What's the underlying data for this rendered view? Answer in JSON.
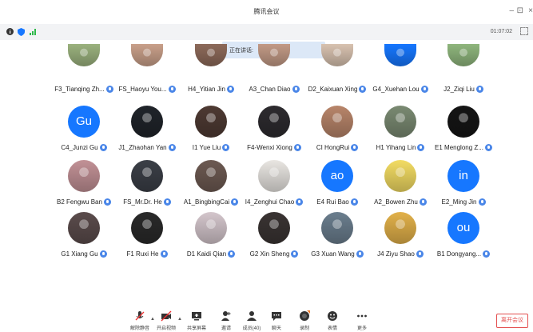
{
  "window": {
    "title": "腾讯会议",
    "minimize_glyph": "–",
    "restore_glyph": "⊡",
    "close_glyph": "×"
  },
  "status": {
    "timer": "01:07:02",
    "icons": [
      "info-icon",
      "shield-icon",
      "signal-icon"
    ]
  },
  "speaking_banner": "正在讲话:",
  "participants": [
    {
      "name": "F3_Tianqing Zh...",
      "initials": "",
      "color": "#9bb27e"
    },
    {
      "name": "FS_Haoyu You...",
      "initials": "",
      "color": "#c9a08a"
    },
    {
      "name": "H4_Yitian Jin",
      "initials": "",
      "color": "#8d6a5a"
    },
    {
      "name": "A3_Chan Diao",
      "initials": "",
      "color": "#c29a86"
    },
    {
      "name": "D2_Kaixuan Xing",
      "initials": "",
      "color": "#d8c2b0"
    },
    {
      "name": "G4_Xuehan Lou",
      "initials": "",
      "color": "#1677ff"
    },
    {
      "name": "J2_Ziqi Liu",
      "initials": "",
      "color": "#8fb67d"
    },
    {
      "name": "C4_Junzi Gu",
      "initials": "Gu",
      "color": "#1677ff"
    },
    {
      "name": "J1_Zhaohan Yan",
      "initials": "",
      "color": "#20242a"
    },
    {
      "name": "I1 Yue Liu",
      "initials": "",
      "color": "#4e3a33"
    },
    {
      "name": "F4-Wenxi Xiong",
      "initials": "",
      "color": "#2d2b2f"
    },
    {
      "name": "CI HongRui",
      "initials": "",
      "color": "#b8856a"
    },
    {
      "name": "H1 Yihang Lin",
      "initials": "",
      "color": "#7a8a72"
    },
    {
      "name": "E1 Menglong Z...",
      "initials": "",
      "color": "#151515"
    },
    {
      "name": "B2 Fengwu Ban",
      "initials": "",
      "color": "#c29196"
    },
    {
      "name": "FS_Mr.Dr. He",
      "initials": "",
      "color": "#3b3f47"
    },
    {
      "name": "A1_BingbingCai",
      "initials": "",
      "color": "#6d5a52"
    },
    {
      "name": "I4_Zenghui Chao",
      "initials": "",
      "color": "#e9e6e2"
    },
    {
      "name": "E4 Rui Bao",
      "initials": "ao",
      "color": "#1677ff"
    },
    {
      "name": "A2_Bowen Zhu",
      "initials": "",
      "color": "#f3dc63"
    },
    {
      "name": "E2_Ming Jin",
      "initials": "in",
      "color": "#1677ff"
    },
    {
      "name": "G1 Xiang Gu",
      "initials": "",
      "color": "#5b4c4c"
    },
    {
      "name": "F1 Ruxi He",
      "initials": "",
      "color": "#2a2a2a"
    },
    {
      "name": "D1 Kaidi Qian",
      "initials": "",
      "color": "#d4c6cc"
    },
    {
      "name": "G2 Xin Sheng",
      "initials": "",
      "color": "#3a3433"
    },
    {
      "name": "G3 Xuan Wang",
      "initials": "",
      "color": "#6b7e8e"
    },
    {
      "name": "J4 Ziyu Shao",
      "initials": "",
      "color": "#e2b14a"
    },
    {
      "name": "B1 Dongyang...",
      "initials": "ou",
      "color": "#1677ff"
    }
  ],
  "toolbar": {
    "buttons": [
      {
        "label": "解除静音",
        "icon": "mic-muted-icon"
      },
      {
        "label": "开启视频",
        "icon": "camera-off-icon"
      },
      {
        "label": "共享屏幕",
        "icon": "share-screen-icon"
      },
      {
        "label": "邀请",
        "icon": "invite-icon"
      },
      {
        "label": "成员(40)",
        "icon": "members-icon"
      },
      {
        "label": "聊天",
        "icon": "chat-icon"
      },
      {
        "label": "录制",
        "icon": "record-icon"
      },
      {
        "label": "表情",
        "icon": "emoji-icon"
      },
      {
        "label": "更多",
        "icon": "more-icon"
      }
    ],
    "caret": "▲",
    "leave_label": "离开会议"
  },
  "colors": {
    "accent": "#1677ff",
    "banner": "#dce8f7",
    "leave": "#e45050",
    "mic": "#4a86e8"
  }
}
